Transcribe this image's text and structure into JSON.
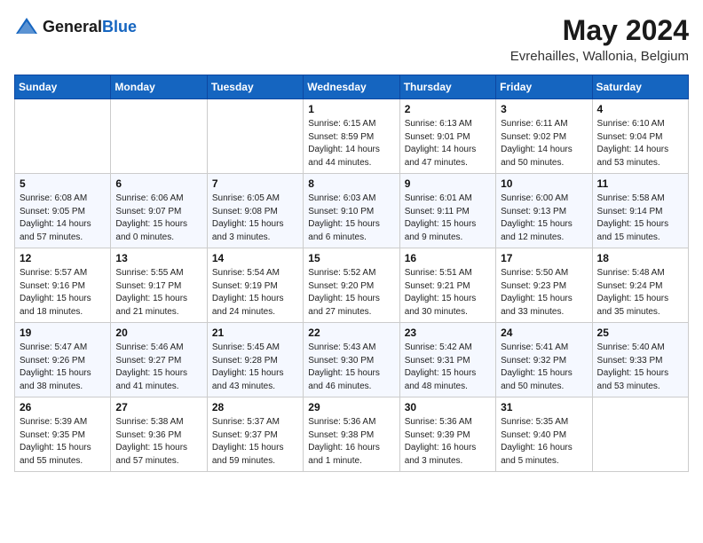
{
  "logo": {
    "general": "General",
    "blue": "Blue"
  },
  "title": "May 2024",
  "subtitle": "Evrehailles, Wallonia, Belgium",
  "weekdays": [
    "Sunday",
    "Monday",
    "Tuesday",
    "Wednesday",
    "Thursday",
    "Friday",
    "Saturday"
  ],
  "weeks": [
    [
      {
        "day": "",
        "sunrise": "",
        "sunset": "",
        "daylight": ""
      },
      {
        "day": "",
        "sunrise": "",
        "sunset": "",
        "daylight": ""
      },
      {
        "day": "",
        "sunrise": "",
        "sunset": "",
        "daylight": ""
      },
      {
        "day": "1",
        "sunrise": "Sunrise: 6:15 AM",
        "sunset": "Sunset: 8:59 PM",
        "daylight": "Daylight: 14 hours and 44 minutes."
      },
      {
        "day": "2",
        "sunrise": "Sunrise: 6:13 AM",
        "sunset": "Sunset: 9:01 PM",
        "daylight": "Daylight: 14 hours and 47 minutes."
      },
      {
        "day": "3",
        "sunrise": "Sunrise: 6:11 AM",
        "sunset": "Sunset: 9:02 PM",
        "daylight": "Daylight: 14 hours and 50 minutes."
      },
      {
        "day": "4",
        "sunrise": "Sunrise: 6:10 AM",
        "sunset": "Sunset: 9:04 PM",
        "daylight": "Daylight: 14 hours and 53 minutes."
      }
    ],
    [
      {
        "day": "5",
        "sunrise": "Sunrise: 6:08 AM",
        "sunset": "Sunset: 9:05 PM",
        "daylight": "Daylight: 14 hours and 57 minutes."
      },
      {
        "day": "6",
        "sunrise": "Sunrise: 6:06 AM",
        "sunset": "Sunset: 9:07 PM",
        "daylight": "Daylight: 15 hours and 0 minutes."
      },
      {
        "day": "7",
        "sunrise": "Sunrise: 6:05 AM",
        "sunset": "Sunset: 9:08 PM",
        "daylight": "Daylight: 15 hours and 3 minutes."
      },
      {
        "day": "8",
        "sunrise": "Sunrise: 6:03 AM",
        "sunset": "Sunset: 9:10 PM",
        "daylight": "Daylight: 15 hours and 6 minutes."
      },
      {
        "day": "9",
        "sunrise": "Sunrise: 6:01 AM",
        "sunset": "Sunset: 9:11 PM",
        "daylight": "Daylight: 15 hours and 9 minutes."
      },
      {
        "day": "10",
        "sunrise": "Sunrise: 6:00 AM",
        "sunset": "Sunset: 9:13 PM",
        "daylight": "Daylight: 15 hours and 12 minutes."
      },
      {
        "day": "11",
        "sunrise": "Sunrise: 5:58 AM",
        "sunset": "Sunset: 9:14 PM",
        "daylight": "Daylight: 15 hours and 15 minutes."
      }
    ],
    [
      {
        "day": "12",
        "sunrise": "Sunrise: 5:57 AM",
        "sunset": "Sunset: 9:16 PM",
        "daylight": "Daylight: 15 hours and 18 minutes."
      },
      {
        "day": "13",
        "sunrise": "Sunrise: 5:55 AM",
        "sunset": "Sunset: 9:17 PM",
        "daylight": "Daylight: 15 hours and 21 minutes."
      },
      {
        "day": "14",
        "sunrise": "Sunrise: 5:54 AM",
        "sunset": "Sunset: 9:19 PM",
        "daylight": "Daylight: 15 hours and 24 minutes."
      },
      {
        "day": "15",
        "sunrise": "Sunrise: 5:52 AM",
        "sunset": "Sunset: 9:20 PM",
        "daylight": "Daylight: 15 hours and 27 minutes."
      },
      {
        "day": "16",
        "sunrise": "Sunrise: 5:51 AM",
        "sunset": "Sunset: 9:21 PM",
        "daylight": "Daylight: 15 hours and 30 minutes."
      },
      {
        "day": "17",
        "sunrise": "Sunrise: 5:50 AM",
        "sunset": "Sunset: 9:23 PM",
        "daylight": "Daylight: 15 hours and 33 minutes."
      },
      {
        "day": "18",
        "sunrise": "Sunrise: 5:48 AM",
        "sunset": "Sunset: 9:24 PM",
        "daylight": "Daylight: 15 hours and 35 minutes."
      }
    ],
    [
      {
        "day": "19",
        "sunrise": "Sunrise: 5:47 AM",
        "sunset": "Sunset: 9:26 PM",
        "daylight": "Daylight: 15 hours and 38 minutes."
      },
      {
        "day": "20",
        "sunrise": "Sunrise: 5:46 AM",
        "sunset": "Sunset: 9:27 PM",
        "daylight": "Daylight: 15 hours and 41 minutes."
      },
      {
        "day": "21",
        "sunrise": "Sunrise: 5:45 AM",
        "sunset": "Sunset: 9:28 PM",
        "daylight": "Daylight: 15 hours and 43 minutes."
      },
      {
        "day": "22",
        "sunrise": "Sunrise: 5:43 AM",
        "sunset": "Sunset: 9:30 PM",
        "daylight": "Daylight: 15 hours and 46 minutes."
      },
      {
        "day": "23",
        "sunrise": "Sunrise: 5:42 AM",
        "sunset": "Sunset: 9:31 PM",
        "daylight": "Daylight: 15 hours and 48 minutes."
      },
      {
        "day": "24",
        "sunrise": "Sunrise: 5:41 AM",
        "sunset": "Sunset: 9:32 PM",
        "daylight": "Daylight: 15 hours and 50 minutes."
      },
      {
        "day": "25",
        "sunrise": "Sunrise: 5:40 AM",
        "sunset": "Sunset: 9:33 PM",
        "daylight": "Daylight: 15 hours and 53 minutes."
      }
    ],
    [
      {
        "day": "26",
        "sunrise": "Sunrise: 5:39 AM",
        "sunset": "Sunset: 9:35 PM",
        "daylight": "Daylight: 15 hours and 55 minutes."
      },
      {
        "day": "27",
        "sunrise": "Sunrise: 5:38 AM",
        "sunset": "Sunset: 9:36 PM",
        "daylight": "Daylight: 15 hours and 57 minutes."
      },
      {
        "day": "28",
        "sunrise": "Sunrise: 5:37 AM",
        "sunset": "Sunset: 9:37 PM",
        "daylight": "Daylight: 15 hours and 59 minutes."
      },
      {
        "day": "29",
        "sunrise": "Sunrise: 5:36 AM",
        "sunset": "Sunset: 9:38 PM",
        "daylight": "Daylight: 16 hours and 1 minute."
      },
      {
        "day": "30",
        "sunrise": "Sunrise: 5:36 AM",
        "sunset": "Sunset: 9:39 PM",
        "daylight": "Daylight: 16 hours and 3 minutes."
      },
      {
        "day": "31",
        "sunrise": "Sunrise: 5:35 AM",
        "sunset": "Sunset: 9:40 PM",
        "daylight": "Daylight: 16 hours and 5 minutes."
      },
      {
        "day": "",
        "sunrise": "",
        "sunset": "",
        "daylight": ""
      }
    ]
  ]
}
